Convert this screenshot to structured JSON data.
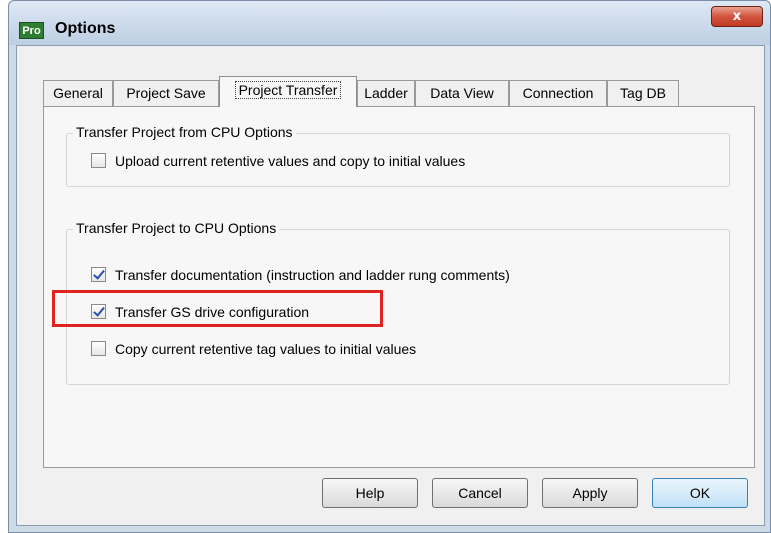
{
  "window": {
    "title": "Options",
    "app_icon_text": "Pro",
    "close_label": "x"
  },
  "tabs": [
    {
      "label": "General"
    },
    {
      "label": "Project Save"
    },
    {
      "label": "Project Transfer"
    },
    {
      "label": "Ladder"
    },
    {
      "label": "Data View"
    },
    {
      "label": "Connection"
    },
    {
      "label": "Tag DB"
    }
  ],
  "active_tab": "Project Transfer",
  "groups": {
    "from_cpu": {
      "title": "Transfer Project from CPU Options",
      "options": [
        {
          "label": "Upload current retentive values and copy to initial values",
          "checked": false
        }
      ]
    },
    "to_cpu": {
      "title": "Transfer Project to CPU Options",
      "options": [
        {
          "label": "Transfer documentation (instruction and ladder rung comments)",
          "checked": true
        },
        {
          "label": "Transfer GS drive configuration",
          "checked": true
        },
        {
          "label": "Copy current retentive tag values to initial values",
          "checked": false
        }
      ]
    }
  },
  "buttons": {
    "help": "Help",
    "cancel": "Cancel",
    "apply": "Apply",
    "ok": "OK"
  },
  "colors": {
    "highlight": "#e0231f",
    "check": "#2a4fb0",
    "default_button_border": "#3c7fb1"
  }
}
